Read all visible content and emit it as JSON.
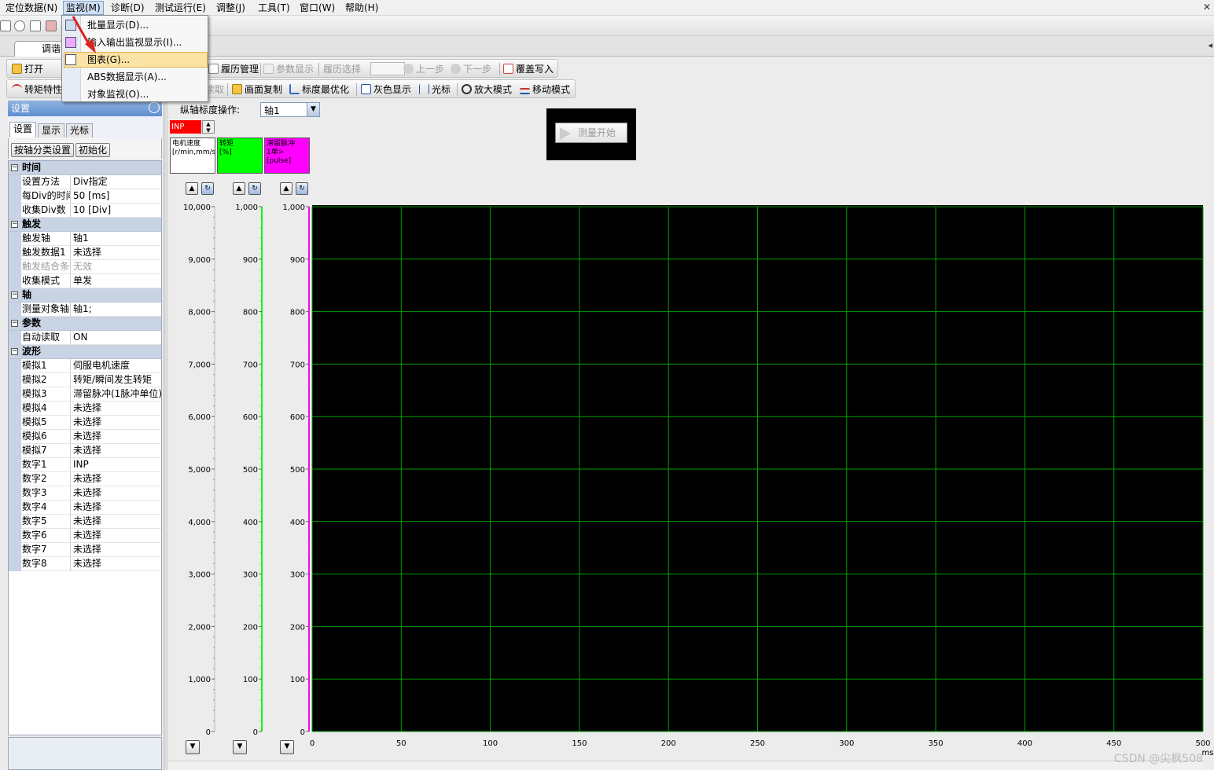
{
  "menubar": {
    "items": [
      "定位数据(N)",
      "监视(M)",
      "诊断(D)",
      "测试运行(E)",
      "调整(J)",
      "工具(T)",
      "窗口(W)",
      "帮助(H)"
    ]
  },
  "dropdown": {
    "items": [
      "批量显示(D)...",
      "输入输出监视显示(I)...",
      "图表(G)...",
      "ABS数据显示(A)...",
      "对象监视(O)..."
    ],
    "highlighted_index": 2
  },
  "tab": {
    "label": "调谐"
  },
  "toolbar1": {
    "open": "打开",
    "history": "履历管理",
    "param_display": "参数显示",
    "history_select": "履历选择",
    "prev": "上一步",
    "next": "下一步",
    "overwrite": "覆盖写入"
  },
  "toolbar2": {
    "torque": "转矩特性",
    "read": "读取",
    "screen_copy": "画面复制",
    "scale_opt": "标度最优化",
    "gray": "灰色显示",
    "cursor": "光标",
    "zoom": "放大模式",
    "move": "移动模式"
  },
  "panel": {
    "title": "设置",
    "tabs": [
      "设置",
      "显示",
      "光标"
    ],
    "btn_axis_category": "按轴分类设置",
    "btn_init": "初始化",
    "categories": [
      {
        "name": "时间",
        "rows": [
          {
            "name": "设置方法",
            "value": "Div指定"
          },
          {
            "name": "每Div的时间",
            "value": "50 [ms]"
          },
          {
            "name": "收集Div数",
            "value": "10 [Div]"
          }
        ]
      },
      {
        "name": "触发",
        "rows": [
          {
            "name": "触发轴",
            "value": "轴1"
          },
          {
            "name": "触发数据1",
            "value": "未选择"
          },
          {
            "name": "触发结合条件",
            "value": "无效",
            "disabled": true
          },
          {
            "name": "收集模式",
            "value": "单发"
          }
        ]
      },
      {
        "name": "轴",
        "rows": [
          {
            "name": "测量对象轴",
            "value": "轴1;"
          }
        ]
      },
      {
        "name": "参数",
        "rows": [
          {
            "name": "自动读取",
            "value": "ON"
          }
        ]
      },
      {
        "name": "波形",
        "rows": [
          {
            "name": "模拟1",
            "value": "伺服电机速度"
          },
          {
            "name": "模拟2",
            "value": "转矩/瞬间发生转矩"
          },
          {
            "name": "模拟3",
            "value": "滞留脉冲(1脉冲单位)"
          },
          {
            "name": "模拟4",
            "value": "未选择"
          },
          {
            "name": "模拟5",
            "value": "未选择"
          },
          {
            "name": "模拟6",
            "value": "未选择"
          },
          {
            "name": "模拟7",
            "value": "未选择"
          },
          {
            "name": "数字1",
            "value": "INP"
          },
          {
            "name": "数字2",
            "value": "未选择"
          },
          {
            "name": "数字3",
            "value": "未选择"
          },
          {
            "name": "数字4",
            "value": "未选择"
          },
          {
            "name": "数字5",
            "value": "未选择"
          },
          {
            "name": "数字6",
            "value": "未选择"
          },
          {
            "name": "数字7",
            "value": "未选择"
          },
          {
            "name": "数字8",
            "value": "未选择"
          }
        ]
      }
    ]
  },
  "chart_header": {
    "axis_op_label": "纵轴标度操作:",
    "axis_value": "轴1",
    "inp_label": "INP",
    "measure_btn": "测量开始"
  },
  "legends": [
    {
      "line1": "电机速度",
      "line2": "[r/min,mm/s]",
      "line3": "",
      "color": "#ffffff",
      "text_color": "#000000"
    },
    {
      "line1": "转矩",
      "line2": "[%]",
      "line3": "",
      "color": "#00ff00",
      "text_color": "#000000"
    },
    {
      "line1": "滞留脉冲",
      "line2": "1单>",
      "line3": "[pulse]",
      "color": "#ff00ff",
      "text_color": "#000000"
    }
  ],
  "chart_data": {
    "type": "line",
    "xlabel": "ms",
    "xlim": [
      0,
      500
    ],
    "x_ticks": [
      "0",
      "50",
      "100",
      "150",
      "200",
      "250",
      "300",
      "350",
      "400",
      "450",
      "500"
    ],
    "y_axes": [
      {
        "ylim": [
          0,
          10000
        ],
        "ticks": [
          "10,000",
          "9,000",
          "8,000",
          "7,000",
          "6,000",
          "5,000",
          "4,000",
          "3,000",
          "2,000",
          "1,000",
          "0"
        ],
        "color": "#ffffff"
      },
      {
        "ylim": [
          0,
          1000
        ],
        "ticks": [
          "1,000",
          "900",
          "800",
          "700",
          "600",
          "500",
          "400",
          "300",
          "200",
          "100",
          "0"
        ],
        "color": "#00ff00"
      },
      {
        "ylim": [
          0,
          1000
        ],
        "ticks": [
          "1,000",
          "900",
          "800",
          "700",
          "600",
          "500",
          "400",
          "300",
          "200",
          "100",
          "0"
        ],
        "color": "#ff00ff"
      }
    ],
    "series": [],
    "grid": true,
    "background": "#000000",
    "grid_color": "#00a000"
  },
  "watermark": "CSDN @尖枫508",
  "colors": {
    "accent": "#5f8fcf",
    "arrow": "#e02020"
  }
}
